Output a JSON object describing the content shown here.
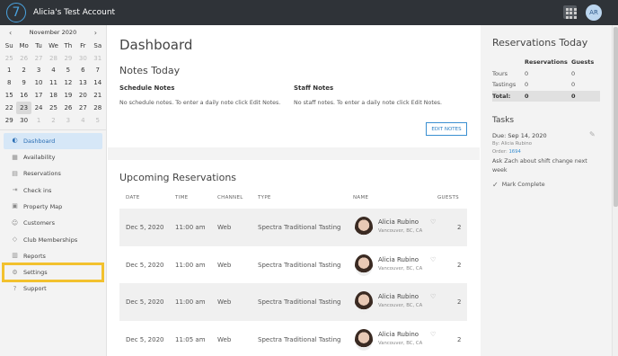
{
  "header": {
    "logo_glyph": "7",
    "account_name": "Alicia's Test Account",
    "avatar_initials": "AR"
  },
  "calendar": {
    "month_label": "November 2020",
    "prev": "‹",
    "next": "›",
    "weekdays": [
      "Su",
      "Mo",
      "Tu",
      "We",
      "Th",
      "Fr",
      "Sa"
    ],
    "weeks": [
      [
        "25",
        "26",
        "27",
        "28",
        "29",
        "30",
        "31"
      ],
      [
        "1",
        "2",
        "3",
        "4",
        "5",
        "6",
        "7"
      ],
      [
        "8",
        "9",
        "10",
        "11",
        "12",
        "13",
        "14"
      ],
      [
        "15",
        "16",
        "17",
        "18",
        "19",
        "20",
        "21"
      ],
      [
        "22",
        "23",
        "24",
        "25",
        "26",
        "27",
        "28"
      ],
      [
        "29",
        "30",
        "1",
        "2",
        "3",
        "4",
        "5"
      ]
    ]
  },
  "sidebar": {
    "items": [
      {
        "label": "Dashboard",
        "icon": "dashboard-icon",
        "glyph": "◐"
      },
      {
        "label": "Availability",
        "icon": "availability-icon",
        "glyph": "▦"
      },
      {
        "label": "Reservations",
        "icon": "reservations-icon",
        "glyph": "▤"
      },
      {
        "label": "Check ins",
        "icon": "checkins-icon",
        "glyph": "⇥"
      },
      {
        "label": "Property Map",
        "icon": "map-icon",
        "glyph": "▣"
      },
      {
        "label": "Customers",
        "icon": "customers-icon",
        "glyph": "☺"
      },
      {
        "label": "Club Memberships",
        "icon": "club-icon",
        "glyph": "◇"
      },
      {
        "label": "Reports",
        "icon": "reports-icon",
        "glyph": "▥"
      },
      {
        "label": "Settings",
        "icon": "settings-icon",
        "glyph": "⚙"
      },
      {
        "label": "Support",
        "icon": "support-icon",
        "glyph": "?"
      }
    ]
  },
  "main": {
    "title": "Dashboard",
    "notes_title": "Notes Today",
    "schedule_notes_label": "Schedule Notes",
    "schedule_notes_text": "No schedule notes. To enter a daily note click Edit Notes.",
    "staff_notes_label": "Staff Notes",
    "staff_notes_text": "No staff notes. To enter a daily note click Edit Notes.",
    "edit_button": "EDIT NOTES",
    "upcoming_title": "Upcoming Reservations",
    "columns": {
      "date": "DATE",
      "time": "TIME",
      "channel": "CHANNEL",
      "type": "TYPE",
      "name": "NAME",
      "guests": "GUESTS"
    },
    "reservations": [
      {
        "date": "Dec 5, 2020",
        "time": "11:00 am",
        "channel": "Web",
        "type": "Spectra Traditional Tasting",
        "name": "Alicia Rubino",
        "location": "Vancouver, BC, CA",
        "guests": "2"
      },
      {
        "date": "Dec 5, 2020",
        "time": "11:00 am",
        "channel": "Web",
        "type": "Spectra Traditional Tasting",
        "name": "Alicia Rubino",
        "location": "Vancouver, BC, CA",
        "guests": "2"
      },
      {
        "date": "Dec 5, 2020",
        "time": "11:00 am",
        "channel": "Web",
        "type": "Spectra Traditional Tasting",
        "name": "Alicia Rubino",
        "location": "Vancouver, BC, CA",
        "guests": "2"
      },
      {
        "date": "Dec 5, 2020",
        "time": "11:05 am",
        "channel": "Web",
        "type": "Spectra Traditional Tasting",
        "name": "Alicia Rubino",
        "location": "Vancouver, BC, CA",
        "guests": "2"
      }
    ]
  },
  "right": {
    "title": "Reservations Today",
    "col_reservations": "Reservations",
    "col_guests": "Guests",
    "rows": [
      {
        "label": "Tours",
        "reservations": "0",
        "guests": "0"
      },
      {
        "label": "Tastings",
        "reservations": "0",
        "guests": "0"
      }
    ],
    "total": {
      "label": "Total:",
      "reservations": "0",
      "guests": "0"
    },
    "tasks_title": "Tasks",
    "task": {
      "due": "Due: Sep 14, 2020",
      "by": "By: Alicia Rubino",
      "order_label": "Order:",
      "order_number": "1694",
      "text": "Ask Zach about shift change next week",
      "mark_complete": "Mark Complete"
    }
  },
  "colors": {
    "accent": "#2a6eb4",
    "highlight": "#f2c12e",
    "topbar": "#2f3338"
  }
}
